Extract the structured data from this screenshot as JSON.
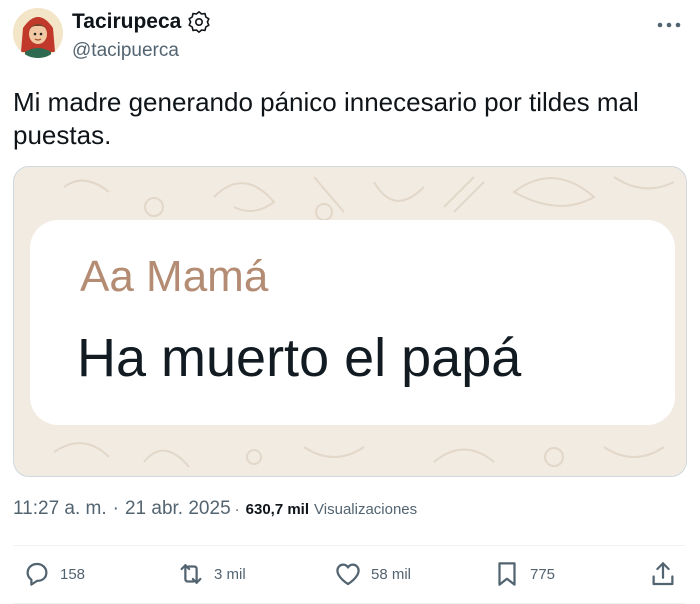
{
  "author": {
    "display_name": "Tacirupeca",
    "handle": "@tacipuerca"
  },
  "tweet": {
    "text": "Mi madre generando pánico innecesario por tildes mal puestas."
  },
  "media": {
    "sender": "Aa Mamá",
    "message": "Ha muerto el papá"
  },
  "meta": {
    "time": "11:27 a. m.",
    "separator": "·",
    "date": "21 abr. 2025",
    "views_count": "630,7 mil",
    "views_label": "Visualizaciones"
  },
  "actions": {
    "replies": "158",
    "reposts": "3 mil",
    "likes": "58 mil",
    "bookmarks": "775"
  },
  "icons": {
    "verified": "verified-badge-icon",
    "more": "more-options-icon",
    "reply": "reply-icon",
    "repost": "repost-icon",
    "like": "like-icon",
    "bookmark": "bookmark-icon",
    "share": "share-icon"
  }
}
